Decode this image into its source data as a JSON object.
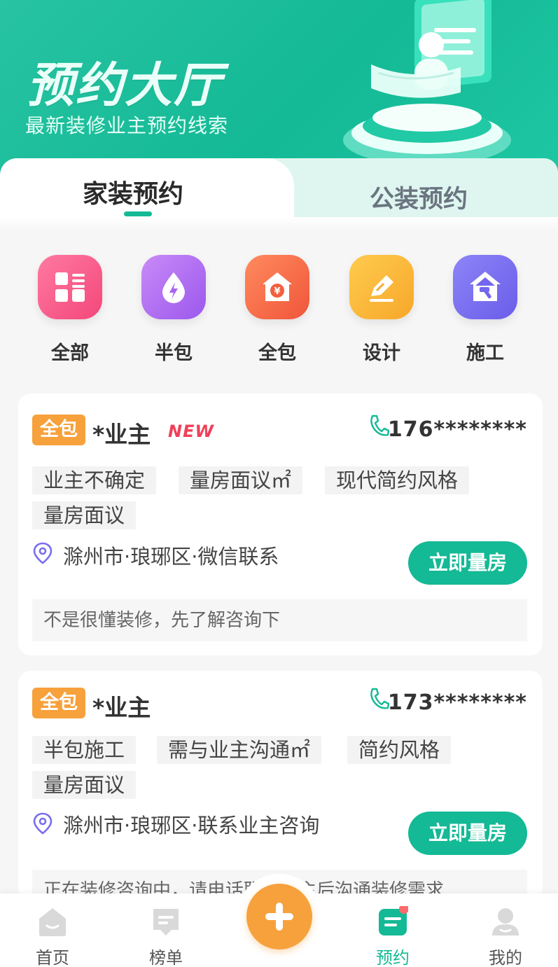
{
  "header": {
    "title": "预约大厅",
    "subtitle": "最新装修业主预约线索"
  },
  "tabs": [
    {
      "label": "家装预约",
      "active": true
    },
    {
      "label": "公装预约",
      "active": false
    }
  ],
  "categories": [
    {
      "label": "全部",
      "icon": "grid-icon",
      "color": "#f5557f"
    },
    {
      "label": "半包",
      "icon": "droplet-bolt-icon",
      "color": "#b06cf0"
    },
    {
      "label": "全包",
      "icon": "house-yen-icon",
      "color": "#f56b45"
    },
    {
      "label": "设计",
      "icon": "pen-icon",
      "color": "#f9b93a"
    },
    {
      "label": "施工",
      "icon": "house-hammer-icon",
      "color": "#7a6df0"
    }
  ],
  "leads": [
    {
      "badge": "全包",
      "owner": "*业主",
      "new_tag": "NEW",
      "phone": "176********",
      "tags": [
        "业主不确定",
        "量房面议㎡",
        "现代简约风格",
        "量房面议"
      ],
      "location": "滁州市·琅琊区·微信联系",
      "action": "立即量房",
      "note": "不是很懂装修，先了解咨询下"
    },
    {
      "badge": "全包",
      "owner": "*业主",
      "phone": "173********",
      "tags": [
        "半包施工",
        "需与业主沟通㎡",
        "简约风格",
        "量房面议"
      ],
      "location": "滁州市·琅琊区·联系业主咨询",
      "action": "立即量房",
      "note": "正在装修咨询中，请电话联系业主后沟通装修需求…"
    }
  ],
  "bottom_nav": [
    {
      "label": "首页",
      "icon": "home-icon",
      "active": false
    },
    {
      "label": "榜单",
      "icon": "ranking-icon",
      "active": false
    },
    {
      "label": "",
      "icon": "plus-icon",
      "active": false
    },
    {
      "label": "预约",
      "icon": "booking-icon",
      "active": true
    },
    {
      "label": "我的",
      "icon": "profile-icon",
      "active": false
    }
  ],
  "colors": {
    "brand": "#14b995",
    "accent": "#f7a13c",
    "new_tag": "#f0405a"
  }
}
